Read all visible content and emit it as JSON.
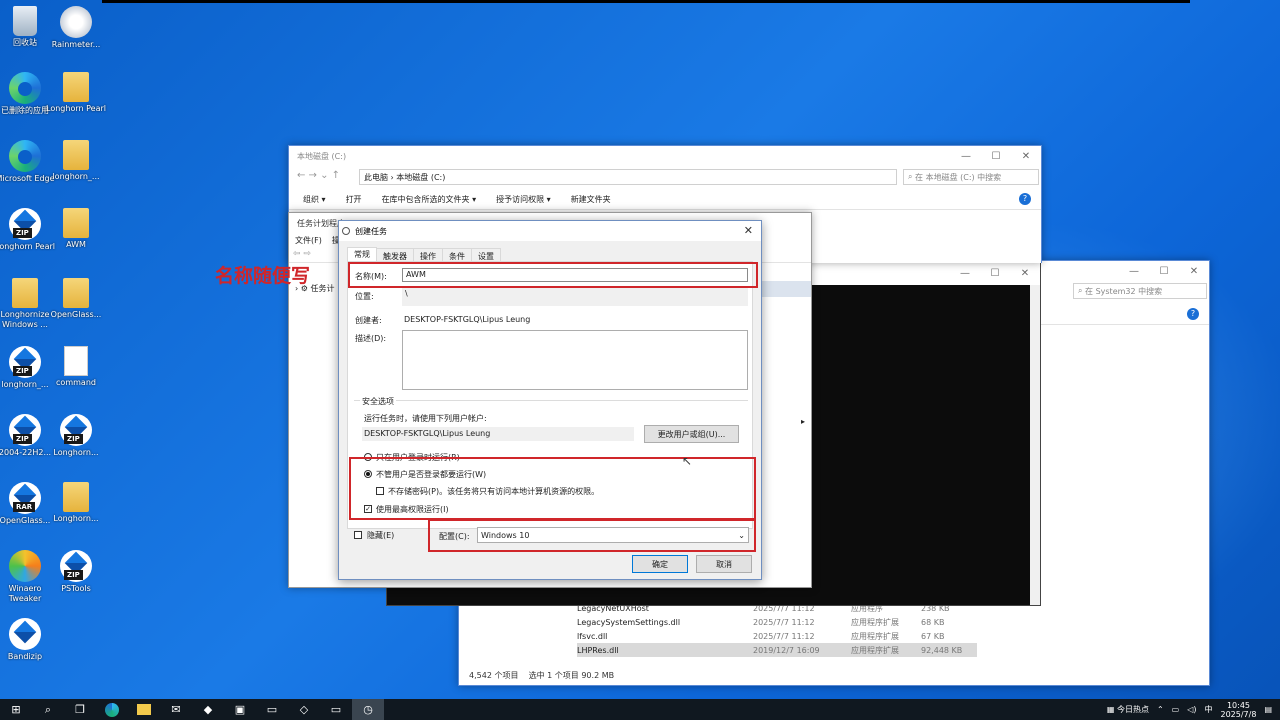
{
  "desktop": {
    "icons": [
      {
        "label": "回收站"
      },
      {
        "label": "Rainmeter..."
      },
      {
        "label": "已删除的应用"
      },
      {
        "label": "Longhorn Pearl"
      },
      {
        "label": "Microsoft Edge"
      },
      {
        "label": "longhorn_..."
      },
      {
        "label": "Longhorn Pearl"
      },
      {
        "label": "AWM"
      },
      {
        "label": "Longhornize Windows ..."
      },
      {
        "label": "OpenGlass..."
      },
      {
        "label": "longhorn_..."
      },
      {
        "label": "command"
      },
      {
        "label": "2004-22H2..."
      },
      {
        "label": "Longhorn..."
      },
      {
        "label": "OpenGlass..."
      },
      {
        "label": "Longhorn..."
      },
      {
        "label": "Winaero Tweaker"
      },
      {
        "label": "PSTools"
      },
      {
        "label": "Bandizip"
      }
    ]
  },
  "explorer_c": {
    "title": "本地磁盘 (C:)",
    "path_root": "此电脑",
    "path_leaf": "本地磁盘 (C:)",
    "search_placeholder": "在 本地磁盘 (C:) 中搜索",
    "ribbon": [
      "组织 ▾",
      "打开",
      "在库中包含所选的文件夹 ▾",
      "授予访问权限 ▾",
      "新建文件夹"
    ]
  },
  "explorer_sys32": {
    "search_placeholder": "在 System32 中搜索",
    "files": [
      {
        "name": "LegacyNetUXHost",
        "date": "2025/7/7 11:12",
        "type": "应用程序",
        "size": "238 KB"
      },
      {
        "name": "LegacySystemSettings.dll",
        "date": "2025/7/7 11:12",
        "type": "应用程序扩展",
        "size": "68 KB"
      },
      {
        "name": "lfsvc.dll",
        "date": "2025/7/7 11:12",
        "type": "应用程序扩展",
        "size": "67 KB"
      },
      {
        "name": "LHPRes.dll",
        "date": "2019/12/7 16:09",
        "type": "应用程序扩展",
        "size": "92,448 KB"
      }
    ],
    "status_count": "4,542 个项目",
    "status_selected": "选中 1 个项目  90.2 MB"
  },
  "task_scheduler": {
    "title": "任务计划程序",
    "menu": [
      "文件(F)",
      "操"
    ],
    "tree_item": "任务计"
  },
  "dialog": {
    "title": "创建任务",
    "tabs": [
      "常规",
      "触发器",
      "操作",
      "条件",
      "设置"
    ],
    "name_label": "名称(M):",
    "name_value": "AWM",
    "location_label": "位置:",
    "location_value": "\\",
    "author_label": "创建者:",
    "author_value": "DESKTOP-FSKTGLQ\\Lipus Leung",
    "desc_label": "描述(D):",
    "security_title": "安全选项",
    "run_as_prompt": "运行任务时，请使用下列用户帐户:",
    "run_as_user": "DESKTOP-FSKTGLQ\\Lipus Leung",
    "change_user_button": "更改用户或组(U)...",
    "radio_logged_on": "只在用户登录时运行(R)",
    "radio_whether": "不管用户是否登录都要运行(W)",
    "no_store_password": "不存储密码(P)。该任务将只有访问本地计算机资源的权限。",
    "highest_priv": "使用最高权限运行(I)",
    "hidden_label": "隐藏(E)",
    "config_label": "配置(C):",
    "config_value": "Windows 10",
    "ok": "确定",
    "cancel": "取消"
  },
  "annotation": "名称随便写",
  "taskbar": {
    "news": "今日热点",
    "ime": "中",
    "time": "10:45",
    "date": "2025/7/8"
  }
}
